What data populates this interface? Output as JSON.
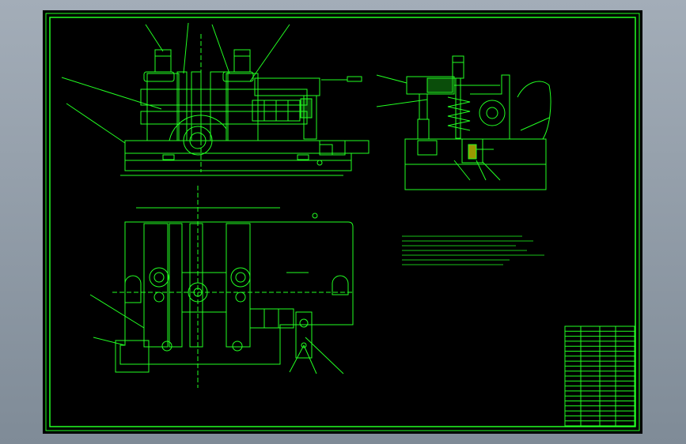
{
  "colors": {
    "background_outer": "#8c97a3",
    "sheet": "#000000",
    "line": "#22ff22",
    "accent": "#ffffff",
    "detail": "#ffff00"
  },
  "views": {
    "front": "front-elevation",
    "side": "side-section",
    "plan": "top-plan"
  },
  "title_block": {
    "rows": 20
  }
}
